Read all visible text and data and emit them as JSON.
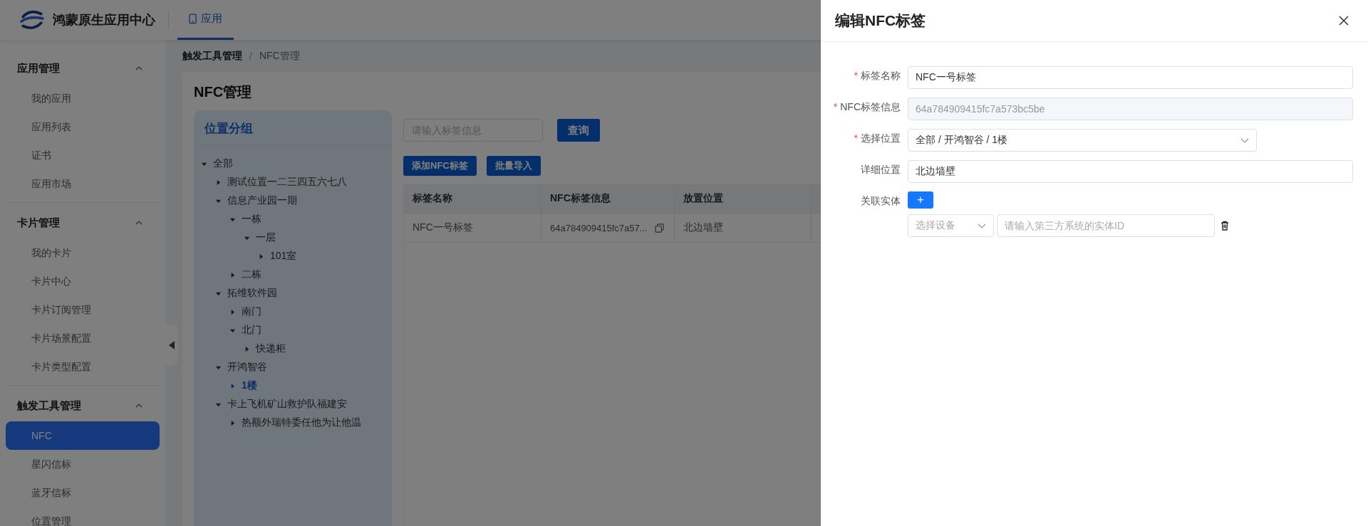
{
  "header": {
    "app_name": "鸿蒙原生应用中心",
    "nav_tabs": [
      {
        "label": "应用",
        "selected": true
      }
    ]
  },
  "sidebar": {
    "groups": [
      {
        "title": "应用管理",
        "expanded": true,
        "items": [
          {
            "label": "我的应用",
            "selected": false
          },
          {
            "label": "应用列表",
            "selected": false
          },
          {
            "label": "证书",
            "selected": false
          },
          {
            "label": "应用市场",
            "selected": false
          }
        ]
      },
      {
        "title": "卡片管理",
        "expanded": true,
        "items": [
          {
            "label": "我的卡片",
            "selected": false
          },
          {
            "label": "卡片中心",
            "selected": false
          },
          {
            "label": "卡片订阅管理",
            "selected": false
          },
          {
            "label": "卡片场景配置",
            "selected": false
          },
          {
            "label": "卡片类型配置",
            "selected": false
          }
        ]
      },
      {
        "title": "触发工具管理",
        "expanded": true,
        "items": [
          {
            "label": "NFC",
            "selected": true
          },
          {
            "label": "星闪信标",
            "selected": false
          },
          {
            "label": "蓝牙信标",
            "selected": false
          },
          {
            "label": "位置管理",
            "selected": false
          }
        ]
      }
    ]
  },
  "breadcrumb": {
    "separator": "/",
    "items": [
      "触发工具管理",
      "NFC管理"
    ]
  },
  "page_title": "NFC管理",
  "location_panel": {
    "title": "位置分组",
    "tree": [
      {
        "label": "全部",
        "expanded": true,
        "selected": false,
        "children": [
          {
            "label": "测试位置一二三四五六七八",
            "expanded": false,
            "selected": false
          },
          {
            "label": "信息产业园一期",
            "expanded": true,
            "selected": false,
            "children": [
              {
                "label": "一栋",
                "expanded": true,
                "selected": false,
                "children": [
                  {
                    "label": "一层",
                    "expanded": true,
                    "selected": false,
                    "children": [
                      {
                        "label": "101室",
                        "expanded": false,
                        "selected": false
                      }
                    ]
                  }
                ]
              },
              {
                "label": "二栋",
                "expanded": false,
                "selected": false
              }
            ]
          },
          {
            "label": "拓维软件园",
            "expanded": true,
            "selected": false,
            "children": [
              {
                "label": "南门",
                "expanded": false,
                "selected": false
              },
              {
                "label": "北门",
                "expanded": true,
                "selected": false,
                "children": [
                  {
                    "label": "快递柜",
                    "expanded": false,
                    "selected": false
                  }
                ]
              }
            ]
          },
          {
            "label": "开鸿智谷",
            "expanded": true,
            "selected": false,
            "children": [
              {
                "label": "1楼",
                "expanded": false,
                "selected": true
              }
            ]
          },
          {
            "label": "卡上飞机矿山救护队福建安",
            "expanded": true,
            "selected": false,
            "children": [
              {
                "label": "热额外瑞特委任他为让他温",
                "expanded": false,
                "selected": false
              }
            ]
          }
        ]
      }
    ]
  },
  "search": {
    "placeholder": "请输入标签信息"
  },
  "query_button": "查询",
  "action_buttons": [
    "添加NFC标签",
    "批量导入"
  ],
  "table": {
    "columns": [
      "标签名称",
      "NFC标签信息",
      "放置位置"
    ],
    "rows": [
      {
        "cells": [
          "NFC一号标签",
          "64a784909415fc7a57...",
          "北边墙壁"
        ]
      }
    ]
  },
  "drawer": {
    "title": "编辑NFC标签",
    "fields": [
      {
        "label": "标签名称",
        "required_mark": "*",
        "kind": "text",
        "value": "NFC一号标签"
      },
      {
        "label": "NFC标签信息",
        "required_mark": "*",
        "kind": "disabled",
        "value": "64a784909415fc7a573bc5be"
      },
      {
        "label": "选择位置",
        "required_mark": "*",
        "kind": "select",
        "value": "全部 / 开鸿智谷 / 1楼"
      },
      {
        "label": "详细位置",
        "kind": "text",
        "value": "北边墙壁"
      }
    ],
    "entities": {
      "label": "关联实体",
      "add_button": "+",
      "rows": [
        {
          "device_placeholder": "选择设备",
          "id_placeholder": "请输入第三方系统的实体ID"
        }
      ]
    }
  }
}
